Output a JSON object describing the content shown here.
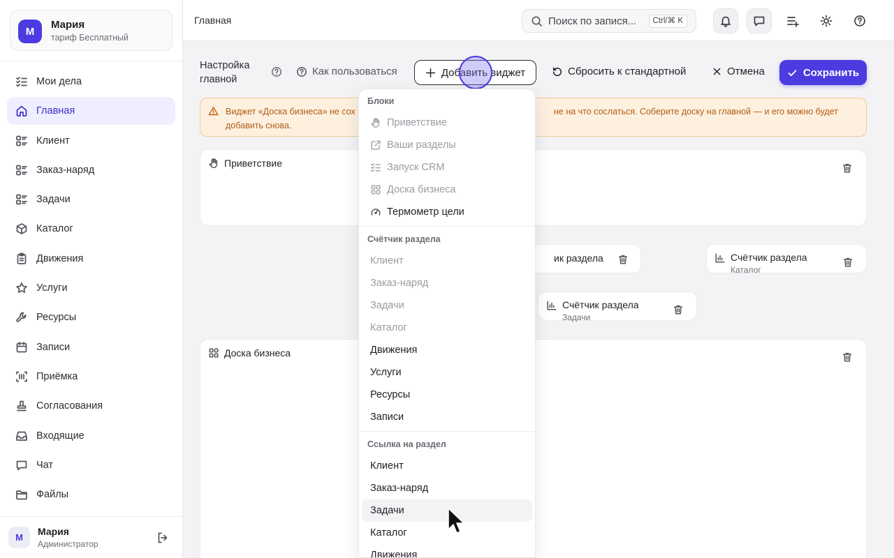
{
  "sidebar": {
    "org": {
      "avatar_letter": "М",
      "name": "Мария",
      "plan": "тариф Бесплатный"
    },
    "items": [
      {
        "label": "Мои дела",
        "icon": "checklist-icon"
      },
      {
        "label": "Главная",
        "icon": "home-icon",
        "active": true
      },
      {
        "label": "Клиент",
        "icon": "list-icon"
      },
      {
        "label": "Заказ-наряд",
        "icon": "list-icon"
      },
      {
        "label": "Задачи",
        "icon": "list-icon"
      },
      {
        "label": "Каталог",
        "icon": "box-icon"
      },
      {
        "label": "Движения",
        "icon": "clipboard-icon"
      },
      {
        "label": "Услуги",
        "icon": "star-icon"
      },
      {
        "label": "Ресурсы",
        "icon": "wrench-icon"
      },
      {
        "label": "Записи",
        "icon": "calendar-icon"
      },
      {
        "label": "Приёмка",
        "icon": "scan-icon"
      },
      {
        "label": "Согласования",
        "icon": "stamp-icon"
      },
      {
        "label": "Входящие",
        "icon": "inbox-icon"
      },
      {
        "label": "Чат",
        "icon": "chat-icon"
      },
      {
        "label": "Файлы",
        "icon": "folder-icon"
      }
    ],
    "user": {
      "avatar_letter": "М",
      "name": "Мария",
      "role": "Администратор"
    }
  },
  "topbar": {
    "breadcrumb": "Главная",
    "search_placeholder": "Поиск по запися...",
    "search_shortcut": "Ctrl/⌘ K"
  },
  "toolbar": {
    "title": "Настройка главной",
    "how_to": "Как пользоваться",
    "add_widget": "Добавить виджет",
    "reset": "Сбросить к стандартной",
    "cancel": "Отмена",
    "save": "Сохранить"
  },
  "warning": {
    "left_text": "Виджет «Доска бизнеса» не сох",
    "right_text_1": "не на что сослаться. Соберите доску на главной — и его можно будет",
    "right_text_2": "добавить снова."
  },
  "widgets": {
    "greeting": {
      "title": "Приветствие"
    },
    "counter_partial": {
      "title": "ик раздела"
    },
    "counter_catalog": {
      "title": "Счётчик раздела",
      "subtitle": "Каталог"
    },
    "counter_tasks": {
      "title": "Счётчик раздела",
      "subtitle": "Задачи"
    },
    "business_board": {
      "title": "Доска бизнеса"
    }
  },
  "dropdown": {
    "blocks_header": "Блоки",
    "blocks": [
      {
        "label": "Приветствие",
        "icon": "hand-icon",
        "disabled": true
      },
      {
        "label": "Ваши разделы",
        "icon": "external-link-icon",
        "disabled": true
      },
      {
        "label": "Запуск CRM",
        "icon": "checklist-icon",
        "disabled": true
      },
      {
        "label": "Доска бизнеса",
        "icon": "grid-icon",
        "disabled": true
      },
      {
        "label": "Термометр цели",
        "icon": "gauge-icon",
        "disabled": false
      }
    ],
    "counter_header": "Счётчик раздела",
    "counters": [
      {
        "label": "Клиент",
        "disabled": true
      },
      {
        "label": "Заказ-наряд",
        "disabled": true
      },
      {
        "label": "Задачи",
        "disabled": true
      },
      {
        "label": "Каталог",
        "disabled": true
      },
      {
        "label": "Движения",
        "disabled": false
      },
      {
        "label": "Услуги",
        "disabled": false
      },
      {
        "label": "Ресурсы",
        "disabled": false
      },
      {
        "label": "Записи",
        "disabled": false
      }
    ],
    "link_header": "Ссылка на раздел",
    "links": [
      {
        "label": "Клиент"
      },
      {
        "label": "Заказ-наряд"
      },
      {
        "label": "Задачи",
        "hover": true
      },
      {
        "label": "Каталог"
      },
      {
        "label": "Движения"
      }
    ]
  },
  "colors": {
    "accent": "#4b3be0",
    "warning_bg": "#fdf0df",
    "warning_text": "#b25c12"
  }
}
